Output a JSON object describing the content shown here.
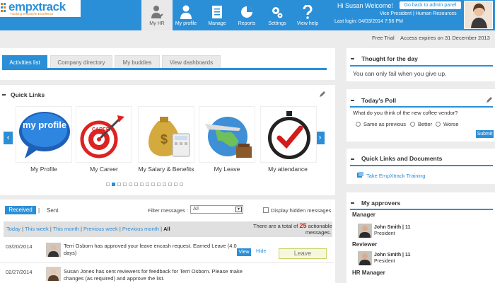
{
  "brand": {
    "name": "empxtrack",
    "tagline": "Tracking Employee Excellence"
  },
  "nav": [
    {
      "label": "My HR",
      "icon": "person-check-icon",
      "active": true
    },
    {
      "label": "My profile",
      "icon": "person-icon",
      "active": false
    },
    {
      "label": "Manage",
      "icon": "clipboard-icon",
      "active": false
    },
    {
      "label": "Reports",
      "icon": "pie-chart-icon",
      "active": false
    },
    {
      "label": "Settings",
      "icon": "gears-icon",
      "active": false
    },
    {
      "label": "View help",
      "icon": "question-icon",
      "active": false
    }
  ],
  "user": {
    "welcome": "Hi Susan Welcome!",
    "admin_button": "Go back to admin panel",
    "role": "Vice President | Human Resources",
    "last_login": "Last login: 04/03/2014 7:56 PM"
  },
  "trial": {
    "label": "Free Trial",
    "expiry": "Access expires on 31 December 2013"
  },
  "tabs": [
    "Activities list",
    "Company directory",
    "My buddies",
    "View dashboards"
  ],
  "quick_links": {
    "title": "Quick Links",
    "items": [
      {
        "label": "My Profile",
        "graphic_text": "my profile"
      },
      {
        "label": "My Career",
        "graphic_text": "CAREER"
      },
      {
        "label": "My Salary & Benefits"
      },
      {
        "label": "My Leave"
      },
      {
        "label": "My attendance"
      }
    ],
    "prev": "‹",
    "next": "›",
    "page_count": 14,
    "current_page": 2
  },
  "messages": {
    "tabs": {
      "received": "Received",
      "separator": "|",
      "sent": "Sent"
    },
    "filter_label": "Filter messages :",
    "filter_value": "All",
    "hidden_label": "Display hidden messages",
    "periods": [
      "Today",
      "This week",
      "This month",
      "Previous week",
      "Previous month",
      "All"
    ],
    "summary_pre": "There are a total of",
    "summary_count": "25",
    "summary_post": "actionable",
    "summary_line2": "messages.",
    "rows": [
      {
        "date": "03/20/2014",
        "text": "Terri Osborn has approved your leave encash request. Earned Leave (4.0 days)",
        "view": "View",
        "hide": "Hide",
        "action": "Leave"
      },
      {
        "date": "02/27/2014",
        "text": "Susan Jones has sent reviewers for feedback for Terri Osborn. Please make changes (as required) and approve the list."
      }
    ]
  },
  "thought": {
    "title": "Thought for the day",
    "text": "You can only fail when you give up."
  },
  "poll": {
    "title": "Today's Poll",
    "question": "What do you think of the new coffee vendor?",
    "options": [
      "Same as previous",
      "Better",
      "Worse"
    ],
    "submit": "Submit"
  },
  "docs": {
    "title": "Quick Links and Documents",
    "link": "Take EmpXtrack Training"
  },
  "approvers": {
    "title": "My approvers",
    "groups": [
      {
        "role": "Manager",
        "name": "John Smith | 11",
        "position": "President"
      },
      {
        "role": "Reviewer",
        "name": "John Smith | 11",
        "position": "President"
      },
      {
        "role": "HR Manager"
      }
    ]
  },
  "colors": {
    "accent": "#2b8fd8",
    "leave_button": "#f7f7dd",
    "count_red": "#d9201a"
  }
}
